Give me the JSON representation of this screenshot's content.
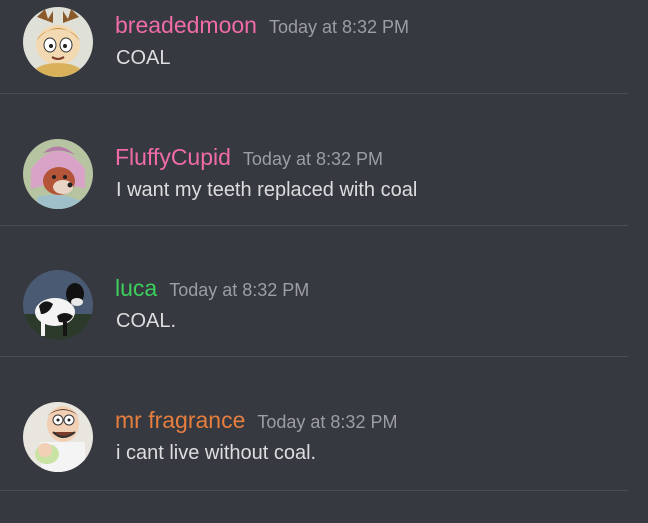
{
  "messages": [
    {
      "username": "breadedmoon",
      "username_color": "#f06ba8",
      "timestamp": "Today at 8:32 PM",
      "content": "COAL",
      "avatar_icon": "cartoon-kid-antlers-avatar-icon"
    },
    {
      "username": "FluffyCupid",
      "username_color": "#f06ba8",
      "timestamp": "Today at 8:32 PM",
      "content": "I want my teeth replaced with coal",
      "avatar_icon": "cartoon-fox-avatar-icon"
    },
    {
      "username": "luca",
      "username_color": "#3ccf5d",
      "timestamp": "Today at 8:32 PM",
      "content": "COAL.",
      "avatar_icon": "cow-avatar-icon"
    },
    {
      "username": "mr fragrance",
      "username_color": "#e67e3f",
      "timestamp": "Today at 8:32 PM",
      "content": "i cant live without coal.",
      "avatar_icon": "cartoon-dad-avatar-icon"
    }
  ]
}
